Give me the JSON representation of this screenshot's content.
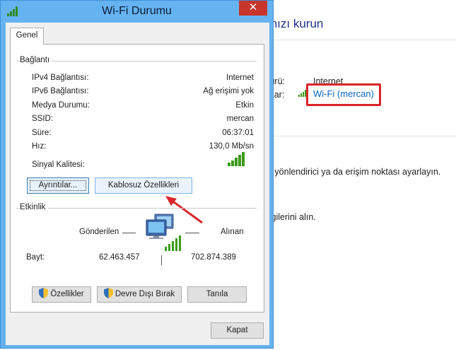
{
  "background": {
    "title_fragment": "ınızı kurun",
    "type_label_fragment": "türü:",
    "type_value": "Internet",
    "connections_label_fragment": "tılar:",
    "connection_link": "Wi-Fi (mercan)",
    "router_text": "ir yönlendirici ya da erişim noktası ayarlayın.",
    "info_text": "ilgilerini alın."
  },
  "dialog": {
    "title": "Wi-Fi Durumu",
    "close_glyph": "✕",
    "tab": "Genel",
    "connection_group": "Bağlantı",
    "rows": [
      {
        "label": "IPv4 Bağlantısı:",
        "value": "Internet"
      },
      {
        "label": "IPv6 Bağlantısı:",
        "value": "Ağ erişimi yok"
      },
      {
        "label": "Medya Durumu:",
        "value": "Etkin"
      },
      {
        "label": "SSID:",
        "value": "mercan"
      },
      {
        "label": "Süre:",
        "value": "06:37:01"
      },
      {
        "label": "Hız:",
        "value": "130,0 Mb/sn"
      }
    ],
    "signal_label": "Sinyal Kalitesi:",
    "signal_bars": 5,
    "details_button": "Ayrıntılar...",
    "wireless_props_button": "Kablosuz Özellikleri",
    "activity_group": "Etkinlik",
    "sent_label": "Gönderilen",
    "received_label": "Alınan",
    "bytes_label": "Bayt:",
    "bytes_sent": "62.463.457",
    "bytes_received": "702.874.389",
    "properties_button": "Özellikler",
    "disable_button": "Devre Dışı Bırak",
    "diagnose_button": "Tanıla",
    "close_button": "Kapat"
  },
  "colors": {
    "dialog_frame": "#66b3f2",
    "close_red": "#c7352c",
    "highlight_red": "#d9252b",
    "link_blue": "#0a66c2",
    "signal_green": "#3a9a1a"
  }
}
